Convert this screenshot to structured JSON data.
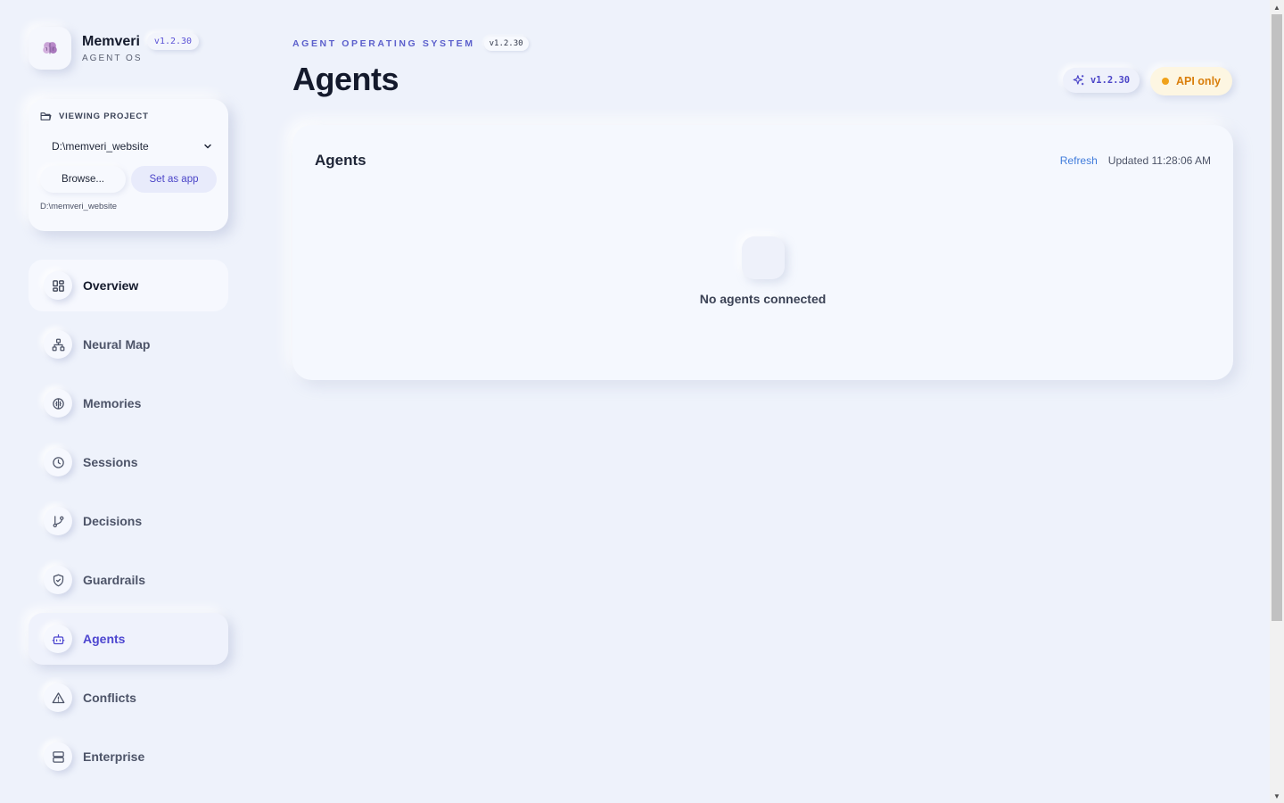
{
  "brand": {
    "name": "Memveri",
    "version": "v1.2.30",
    "subtitle": "AGENT OS",
    "logo_icon": "brain-icon"
  },
  "project": {
    "heading": "VIEWING PROJECT",
    "selected": "D:\\memveri_website",
    "browse_label": "Browse...",
    "set_app_label": "Set as app",
    "path": "D:\\memveri_website"
  },
  "nav": {
    "items": [
      {
        "label": "Overview",
        "icon": "grid-icon"
      },
      {
        "label": "Neural Map",
        "icon": "network-icon"
      },
      {
        "label": "Memories",
        "icon": "brain-icon"
      },
      {
        "label": "Sessions",
        "icon": "clock-icon"
      },
      {
        "label": "Decisions",
        "icon": "git-branch-icon"
      },
      {
        "label": "Guardrails",
        "icon": "shield-icon"
      },
      {
        "label": "Agents",
        "icon": "bot-icon"
      },
      {
        "label": "Conflicts",
        "icon": "warning-icon"
      },
      {
        "label": "Enterprise",
        "icon": "server-icon"
      }
    ],
    "active": "Agents"
  },
  "header": {
    "eyebrow": "AGENT OPERATING SYSTEM",
    "eyebrow_version": "v1.2.30",
    "title": "Agents",
    "version_badge": "v1.2.30",
    "status": "API only"
  },
  "card": {
    "title": "Agents",
    "refresh_label": "Refresh",
    "updated": "Updated 11:28:06 AM",
    "empty_message": "No agents connected"
  },
  "colors": {
    "accent": "#4d46d0",
    "status_warning": "#f0a21a",
    "link": "#3f7bdb",
    "background": "#eef2fb"
  }
}
